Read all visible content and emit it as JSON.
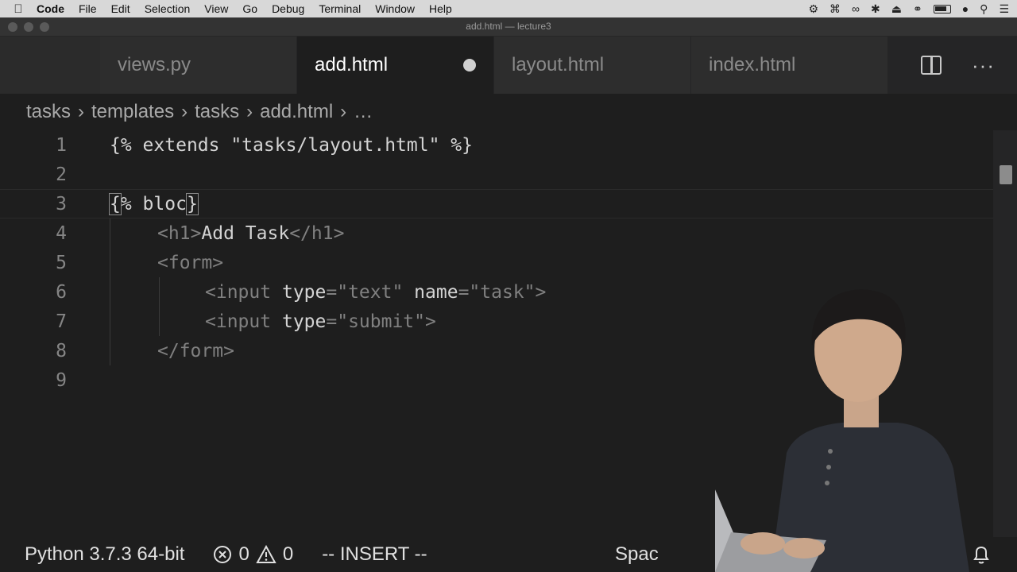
{
  "menubar": {
    "app_name": "Code",
    "items": [
      "File",
      "Edit",
      "Selection",
      "View",
      "Go",
      "Debug",
      "Terminal",
      "Window",
      "Help"
    ]
  },
  "window": {
    "title": "add.html — lecture3"
  },
  "tabs": [
    {
      "label": "views.py",
      "active": false,
      "dirty": false
    },
    {
      "label": "add.html",
      "active": true,
      "dirty": true
    },
    {
      "label": "layout.html",
      "active": false,
      "dirty": false
    },
    {
      "label": "index.html",
      "active": false,
      "dirty": false
    }
  ],
  "breadcrumb": [
    "tasks",
    "templates",
    "tasks",
    "add.html",
    "…"
  ],
  "editor": {
    "lines": [
      "1",
      "2",
      "3",
      "4",
      "5",
      "6",
      "7",
      "8",
      "9"
    ],
    "line1": {
      "open": "{%",
      "keyword": " extends ",
      "str": "\"tasks/layout.html\"",
      "close": " %}"
    },
    "line3": {
      "open": "{",
      "rest": "% bloc",
      "cursor_char": "}"
    },
    "line4": {
      "lt": "<",
      "name": "h1",
      "gt": ">",
      "text": "Add Task",
      "close_lt": "</",
      "close_name": "h1",
      "close_gt": ">"
    },
    "line5": {
      "lt": "<",
      "name": "form",
      "gt": ">"
    },
    "line6": {
      "lt": "<",
      "name": "input",
      "attr1": "type",
      "eq1": "=",
      "val1": "\"text\"",
      "attr2": "name",
      "eq2": "=",
      "val2": "\"task\"",
      "gt": ">"
    },
    "line7": {
      "lt": "<",
      "name": "input",
      "attr1": "type",
      "eq1": "=",
      "val1": "\"submit\"",
      "gt": ">"
    },
    "line8": {
      "lt": "</",
      "name": "form",
      "gt": ">"
    }
  },
  "statusbar": {
    "interpreter": "Python 3.7.3 64-bit",
    "errors": "0",
    "warnings": "0",
    "mode": "-- INSERT --",
    "spaces": "Spac"
  },
  "icons": {
    "error": "x-circle-icon",
    "warning": "warning-triangle-icon",
    "notification": "bell-icon"
  }
}
